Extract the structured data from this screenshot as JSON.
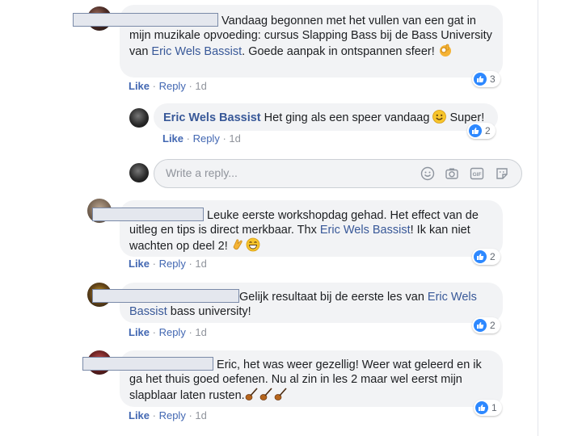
{
  "comments": [
    {
      "text_before": "Vandaag begonnen met het vullen van een gat in mijn muzikale opvoeding: cursus Slapping Bass bij de Bass University van ",
      "mention": "Eric Wels Bassist",
      "text_after": ". Goede aanpak in ontspannen sfeer!",
      "emoji": "ok-hand",
      "like": "Like",
      "reply": "Reply",
      "time": "1d",
      "reaction_count": "3"
    },
    {
      "author": "Eric Wels Bassist",
      "text": "Het ging als een speer vandaag",
      "text_after": "Super!",
      "emoji": "smile",
      "like": "Like",
      "reply": "Reply",
      "time": "1d",
      "reaction_count": "2"
    },
    {
      "text_before": "Leuke eerste workshopdag gehad. Het effect van de uitleg en tips is direct merkbaar. Thx ",
      "mention": "Eric Wels Bassist",
      "text_after": "! Ik kan niet wachten op deel 2!",
      "emoji": "clap-grin",
      "like": "Like",
      "reply": "Reply",
      "time": "1d",
      "reaction_count": "2"
    },
    {
      "text_before": "Gelijk resultaat bij de eerste les van ",
      "mention": "Eric Wels Bassist",
      "text_after": " bass university!",
      "like": "Like",
      "reply": "Reply",
      "time": "1d",
      "reaction_count": "2"
    },
    {
      "text_before": "Eric, het was weer gezellig! Weer wat geleerd en ik ga het thuis goed oefenen. Nu al zin in les 2 maar wel eerst mijn slapblaar laten rusten.",
      "emoji": "guitars",
      "like": "Like",
      "reply": "Reply",
      "time": "1d",
      "reaction_count": "1"
    }
  ],
  "reply_box": {
    "placeholder": "Write a reply...",
    "icons": [
      "emoji-icon",
      "camera-icon",
      "gif-icon",
      "sticker-icon"
    ]
  },
  "colors": {
    "link": "#385898",
    "action": "#4267b2",
    "bubble": "#f2f3f5",
    "like_badge": "#2d88ff"
  }
}
